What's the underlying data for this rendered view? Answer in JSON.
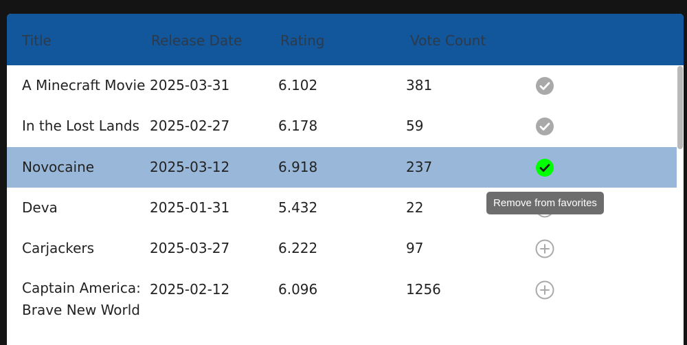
{
  "table": {
    "headers": {
      "title": "Title",
      "release_date": "Release Date",
      "rating": "Rating",
      "vote_count": "Vote Count"
    },
    "rows": [
      {
        "title": "A Minecraft Movie",
        "release_date": "2025-03-31",
        "rating": "6.102",
        "vote_count": "381",
        "favorite": true,
        "selected": false,
        "icon": "check-circle-icon"
      },
      {
        "title": "In the Lost Lands",
        "release_date": "2025-02-27",
        "rating": "6.178",
        "vote_count": "59",
        "favorite": true,
        "selected": false,
        "icon": "check-circle-icon"
      },
      {
        "title": "Novocaine",
        "release_date": "2025-03-12",
        "rating": "6.918",
        "vote_count": "237",
        "favorite": true,
        "selected": true,
        "icon": "check-circle-icon"
      },
      {
        "title": "Deva",
        "release_date": "2025-01-31",
        "rating": "5.432",
        "vote_count": "22",
        "favorite": false,
        "selected": false,
        "icon": "plus-circle-icon"
      },
      {
        "title": "Carjackers",
        "release_date": "2025-03-27",
        "rating": "6.222",
        "vote_count": "97",
        "favorite": false,
        "selected": false,
        "icon": "plus-circle-icon"
      },
      {
        "title": "Captain America: Brave New World",
        "release_date": "2025-02-12",
        "rating": "6.096",
        "vote_count": "1256",
        "favorite": false,
        "selected": false,
        "icon": "plus-circle-icon"
      }
    ]
  },
  "tooltip": {
    "text": "Remove from favorites"
  },
  "colors": {
    "header_bg": "#12569b",
    "selected_row_bg": "#99b8d9",
    "favorite_icon": "#a9a9a9",
    "favorite_icon_active": "#00ff00",
    "add_icon": "#a9a9a9",
    "tooltip_bg": "#6d6d6d"
  }
}
